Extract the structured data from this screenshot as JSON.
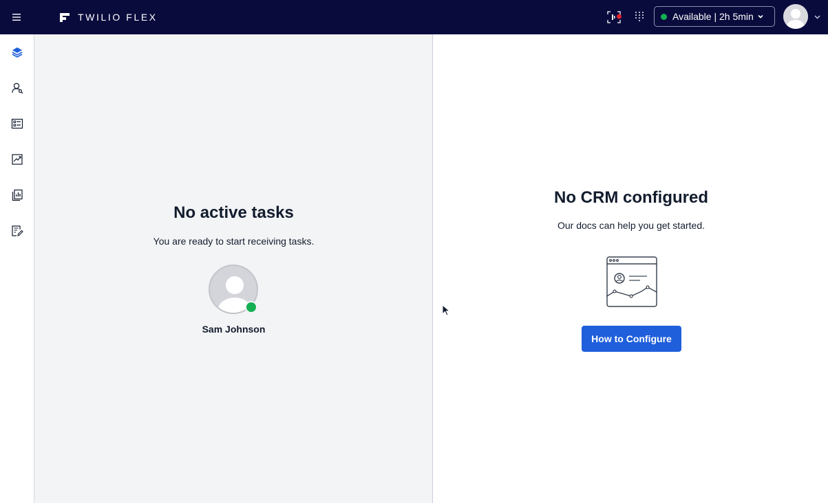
{
  "topbar": {
    "brand_text": "TWILIO FLEX",
    "status_label": "Available | 2h 5min",
    "status_color": "#14b053",
    "background_color": "#0a0b3d",
    "icons": [
      "menu-icon",
      "flex-logo-icon",
      "recording-icon",
      "dialpad-icon",
      "chevron-down-icon",
      "user-avatar-icon"
    ]
  },
  "sidenav": {
    "items": [
      {
        "name": "agent-desktop",
        "icon": "layers-icon",
        "active": true
      },
      {
        "name": "teams",
        "icon": "user-search-icon",
        "active": false
      },
      {
        "name": "queues",
        "icon": "list-card-icon",
        "active": false
      },
      {
        "name": "insights",
        "icon": "chart-line-icon",
        "active": false
      },
      {
        "name": "reports",
        "icon": "report-icon",
        "active": false
      },
      {
        "name": "quality",
        "icon": "document-edit-icon",
        "active": false
      }
    ],
    "active_color": "#1f5fdb"
  },
  "task_panel": {
    "title": "No active tasks",
    "subtitle": "You are ready to start receiving tasks.",
    "agent_name": "Sam Johnson"
  },
  "crm_panel": {
    "title": "No CRM configured",
    "subtitle": "Our docs can help you get started.",
    "button_label": "How to Configure",
    "button_color": "#1f5fdb"
  }
}
